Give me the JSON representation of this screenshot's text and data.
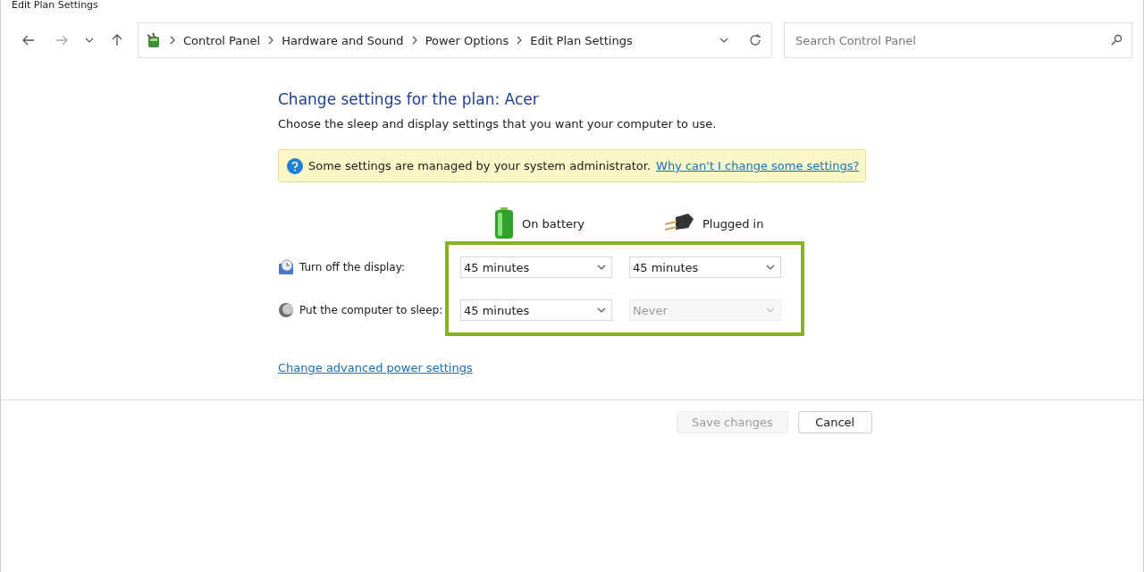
{
  "window": {
    "title": "Edit Plan Settings"
  },
  "breadcrumb": [
    "Control Panel",
    "Hardware and Sound",
    "Power Options",
    "Edit Plan Settings"
  ],
  "search": {
    "placeholder": "Search Control Panel"
  },
  "heading": "Change settings for the plan: Acer",
  "description": "Choose the sleep and display settings that you want your computer to use.",
  "notice": {
    "text": "Some settings are managed by your system administrator.",
    "link": "Why can't I change some settings?"
  },
  "columns": [
    {
      "kind": "battery",
      "label": "On battery"
    },
    {
      "kind": "plug",
      "label": "Plugged in"
    }
  ],
  "settings": [
    {
      "kind": "display",
      "label": "Turn off the display:",
      "values": [
        {
          "value": "45 minutes",
          "disabled": false
        },
        {
          "value": "45 minutes",
          "disabled": false
        }
      ]
    },
    {
      "kind": "sleep",
      "label": "Put the computer to sleep:",
      "values": [
        {
          "value": "45 minutes",
          "disabled": false
        },
        {
          "value": "Never",
          "disabled": true
        }
      ]
    }
  ],
  "advanced_link": "Change advanced power settings",
  "buttons": [
    {
      "label": "Save changes",
      "disabled": true
    },
    {
      "label": "Cancel",
      "disabled": false
    }
  ]
}
